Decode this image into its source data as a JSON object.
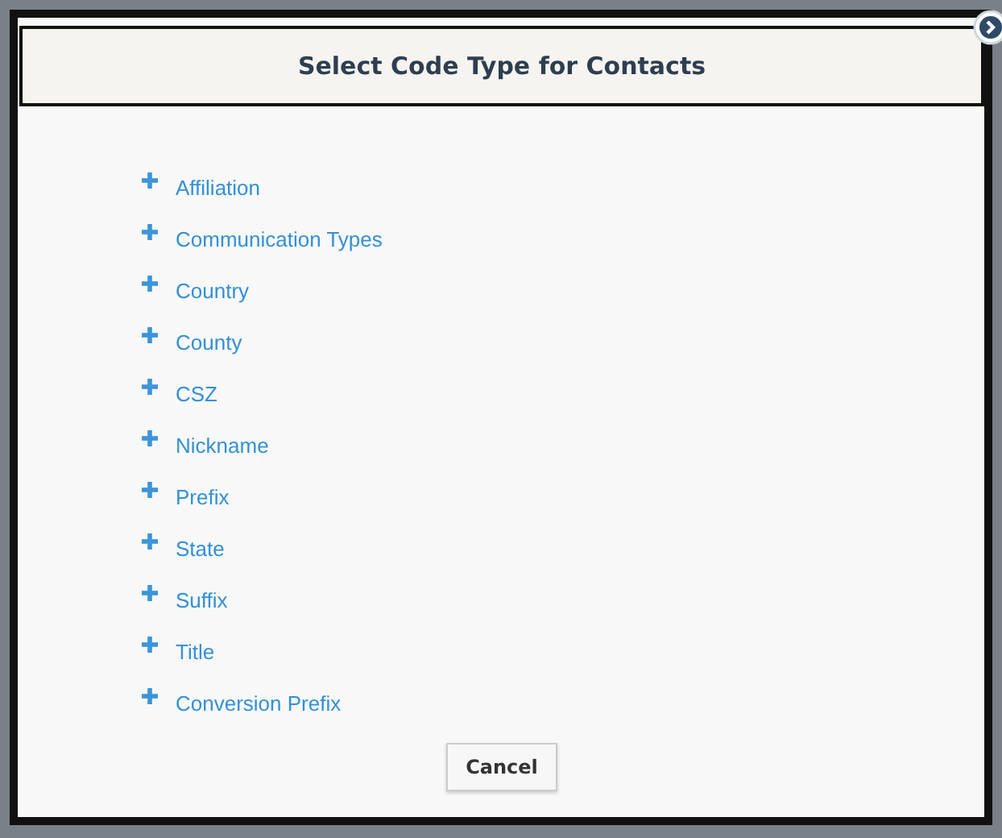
{
  "dialog": {
    "title": "Select Code Type for Contacts",
    "items": [
      {
        "label": "Affiliation",
        "expanded": false
      },
      {
        "label": "Communication Types",
        "expanded": false
      },
      {
        "label": "Country",
        "expanded": false
      },
      {
        "label": "County",
        "expanded": false
      },
      {
        "label": "CSZ",
        "expanded": false
      },
      {
        "label": "Nickname",
        "expanded": false
      },
      {
        "label": "Prefix",
        "expanded": false
      },
      {
        "label": "State",
        "expanded": false
      },
      {
        "label": "Suffix",
        "expanded": false
      },
      {
        "label": "Title",
        "expanded": false
      },
      {
        "label": "Conversion Prefix",
        "expanded": false
      }
    ],
    "buttons": [
      "Cancel"
    ]
  }
}
